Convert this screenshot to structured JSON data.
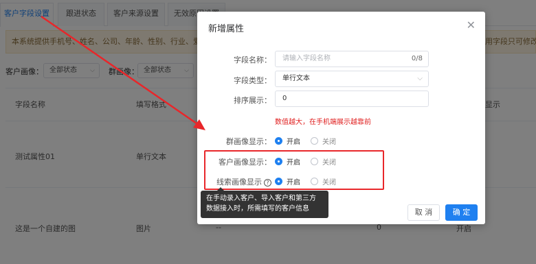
{
  "tabs": [
    {
      "label": "客户字段设置",
      "active": true
    },
    {
      "label": "跟进状态",
      "active": false
    },
    {
      "label": "客户来源设置",
      "active": false
    },
    {
      "label": "无效原因设置",
      "active": false
    }
  ],
  "notice": {
    "text": "本系统提供手机号、姓名、公司、年龄、性别、行业、爱好",
    "right_text": "用字段只可修改"
  },
  "filters": [
    {
      "label": "客户画像：",
      "value": "全部状态"
    },
    {
      "label": "群画像：",
      "value": "全部状态"
    }
  ],
  "table": {
    "headers": [
      "字段名称",
      "填写格式",
      "显示"
    ],
    "rows": [
      {
        "name": "测试属性01",
        "format": "单行文本"
      },
      {
        "name": "这是一个自建的图",
        "format": "图片",
        "extra": "--",
        "order": "0",
        "status": "开启"
      }
    ]
  },
  "dialog": {
    "title": "新增属性",
    "fields": {
      "name_label": "字段名称：",
      "name_placeholder": "请输入字段名称",
      "name_count": "0/8",
      "type_label": "字段类型：",
      "type_value": "单行文本",
      "order_label": "排序展示：",
      "order_value": "0",
      "order_hint": "数值越大，在手机端展示越靠前"
    },
    "radios": [
      {
        "label": "群画像显示：",
        "on": "开启",
        "off": "关闭"
      },
      {
        "label": "客户画像显示：",
        "on": "开启",
        "off": "关闭"
      },
      {
        "label": "线索画像显示",
        "on": "开启",
        "off": "关闭"
      }
    ],
    "cancel_label": "取 消",
    "ok_label": "确 定"
  },
  "tooltip": {
    "line1": "在手动录入客户、导入客户和第三方",
    "line2": "数据接入时，所需填写的客户信息"
  },
  "colors": {
    "accent": "#1f80f0",
    "warning_red": "#e02020",
    "highlight_red": "#e8262a"
  }
}
